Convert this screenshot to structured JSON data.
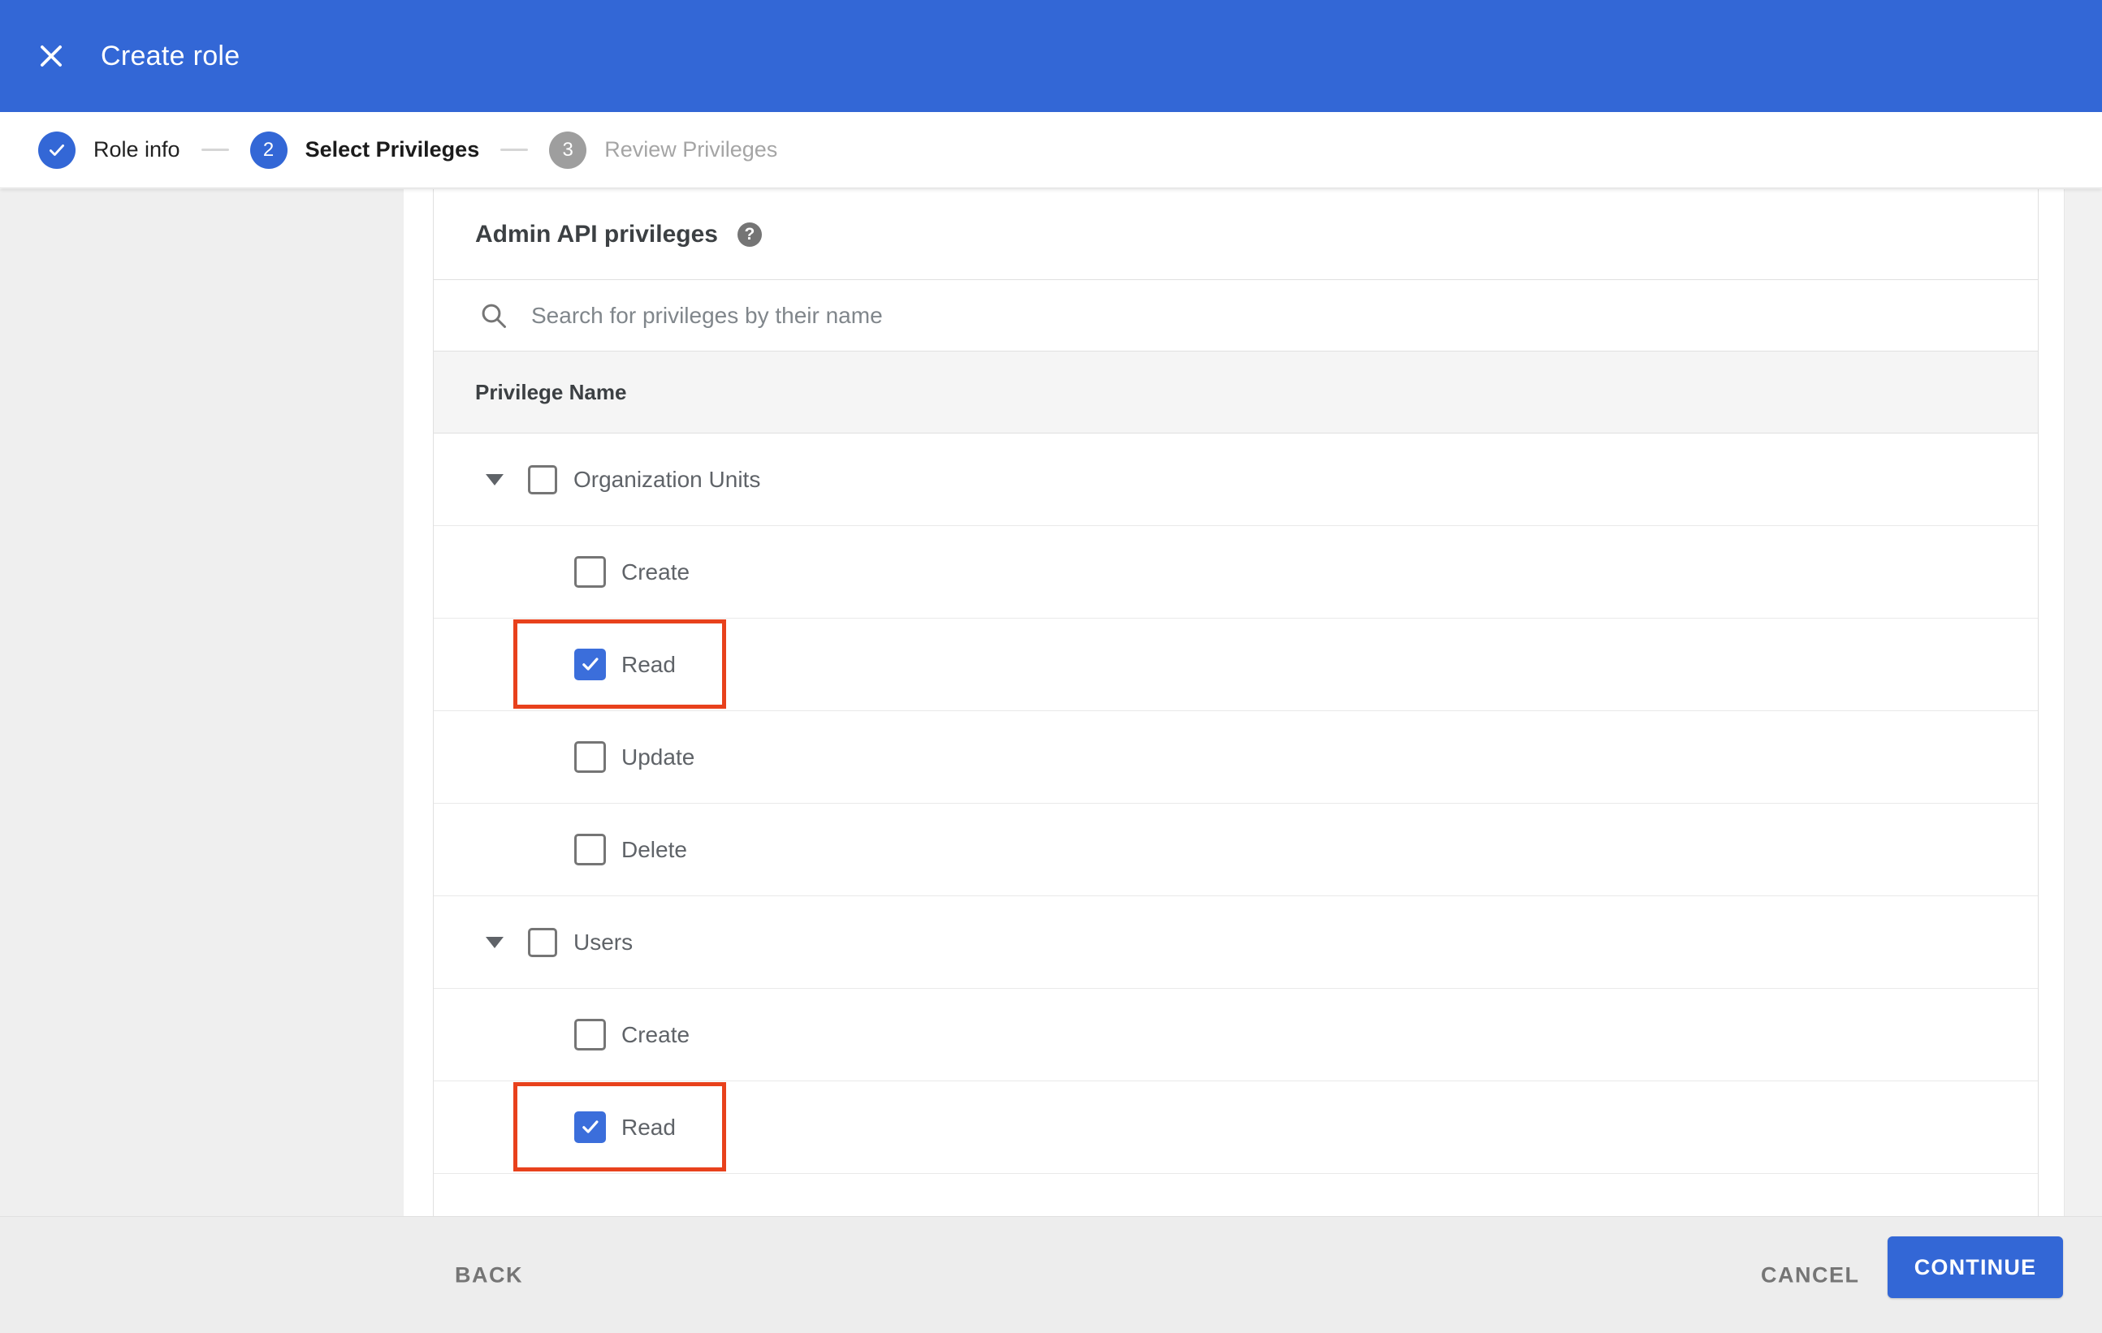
{
  "header": {
    "title": "Create role"
  },
  "stepper": {
    "steps": [
      {
        "label": "Role info",
        "indicator": "check",
        "state": "done"
      },
      {
        "label": "Select Privileges",
        "indicator": "2",
        "state": "active"
      },
      {
        "label": "Review Privileges",
        "indicator": "3",
        "state": "todo"
      }
    ]
  },
  "content": {
    "section_title": "Admin API privileges",
    "help_icon": "question-mark-icon",
    "search": {
      "icon": "magnifier-icon",
      "placeholder": "Search for privileges by their name",
      "value": ""
    },
    "table": {
      "column_header": "Privilege Name",
      "rows": [
        {
          "label": "Organization Units",
          "type": "group",
          "expanded": true,
          "checked": false,
          "highlighted": false
        },
        {
          "label": "Create",
          "type": "child",
          "checked": false,
          "highlighted": false
        },
        {
          "label": "Read",
          "type": "child",
          "checked": true,
          "highlighted": true
        },
        {
          "label": "Update",
          "type": "child",
          "checked": false,
          "highlighted": false
        },
        {
          "label": "Delete",
          "type": "child",
          "checked": false,
          "highlighted": false
        },
        {
          "label": "Users",
          "type": "group",
          "expanded": true,
          "checked": false,
          "highlighted": false
        },
        {
          "label": "Create",
          "type": "child",
          "checked": false,
          "highlighted": false
        },
        {
          "label": "Read",
          "type": "child",
          "checked": true,
          "highlighted": true
        }
      ]
    }
  },
  "footer": {
    "back_label": "BACK",
    "cancel_label": "CANCEL",
    "continue_label": "CONTINUE"
  },
  "colors": {
    "accent_blue": "#3367d6",
    "checkbox_blue": "#3b6edb",
    "highlight_red": "#e8411c",
    "inactive_step_gray": "#9e9e9e",
    "sidebar_gray": "#efefef",
    "footer_gray": "#ededed",
    "table_header_gray": "#f5f5f5"
  }
}
